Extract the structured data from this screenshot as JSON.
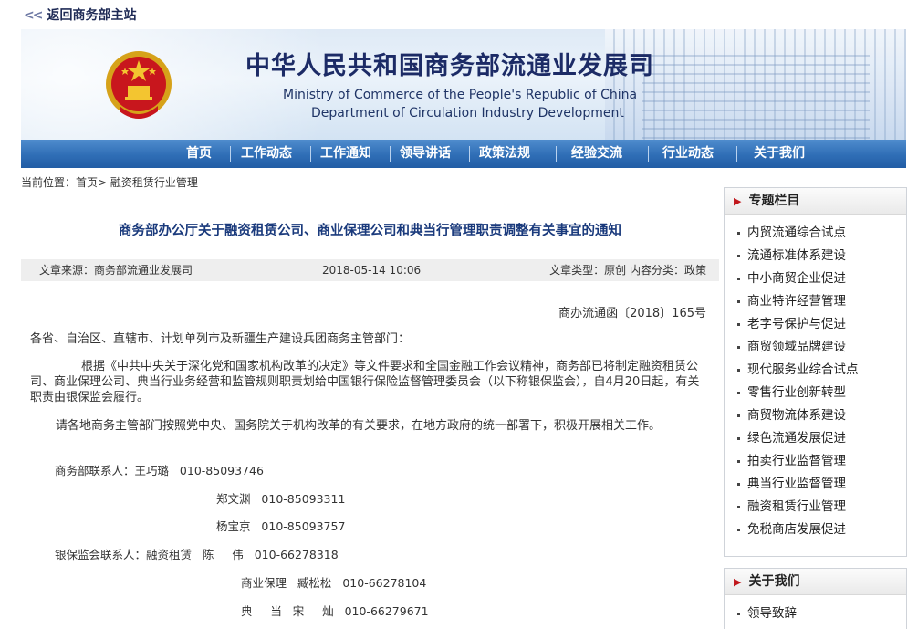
{
  "topbar": {
    "back_label": "返回商务部主站"
  },
  "banner": {
    "title_cn": "中华人民共和国商务部流通业发展司",
    "title_en_1": "Ministry of Commerce of the People's Republic of China",
    "title_en_2": "Department of Circulation Industry Development"
  },
  "nav": [
    "首页",
    "工作动态",
    "工作通知",
    "领导讲话",
    "政策法规",
    "经验交流",
    "行业动态",
    "关于我们"
  ],
  "breadcrumb": {
    "label": "当前位置：",
    "home": "首页",
    "sep": ">",
    "current": "融资租赁行业管理"
  },
  "article": {
    "title": "商务部办公厅关于融资租赁公司、商业保理公司和典当行管理职责调整有关事宜的通知",
    "meta": {
      "source": "文章来源：商务部流通业发展司",
      "date": "2018-05-14 10:06",
      "type": "文章类型：原创 内容分类：政策"
    },
    "doc_no": "商办流通函〔2018〕165号",
    "salutation": "各省、自治区、直辖市、计划单列市及新疆生产建设兵团商务主管部门：",
    "para1": "根据《中共中央关于深化党和国家机构改革的决定》等文件要求和全国金融工作会议精神，商务部已将制定融资租赁公司、商业保理公司、典当行业务经营和监管规则职责划给中国银行保险监督管理委员会（以下称银保监会），自4月20日起，有关职责由银保监会履行。",
    "para2": "请各地商务主管部门按照党中央、国务院关于机构改革的有关要求，在地方政府的统一部署下，积极开展相关工作。",
    "contacts": [
      "商务部联系人：王巧璐   010-85093746",
      "郑文渊   010-85093311",
      "杨宝京   010-85093757",
      "银保监会联系人：融资租赁   陈     伟   010-66278318",
      "商业保理   臧松松   010-66278104",
      "典     当   宋     灿   010-66279671"
    ]
  },
  "sidebar": {
    "topics_title": "专题栏目",
    "topics": [
      "内贸流通综合试点",
      "流通标准体系建设",
      "中小商贸企业促进",
      "商业特许经营管理",
      "老字号保护与促进",
      "商贸领域品牌建设",
      "现代服务业综合试点",
      "零售行业创新转型",
      "商贸物流体系建设",
      "绿色流通发展促进",
      "拍卖行业监督管理",
      "典当行业监督管理",
      "融资租赁行业管理",
      "免税商店发展促进"
    ],
    "about_title": "关于我们",
    "about": [
      "领导致辞"
    ]
  },
  "colors": {
    "nav_blue": "#2f6eb6",
    "title_blue": "#1a3a7c",
    "accent_red": "#c0161b"
  }
}
